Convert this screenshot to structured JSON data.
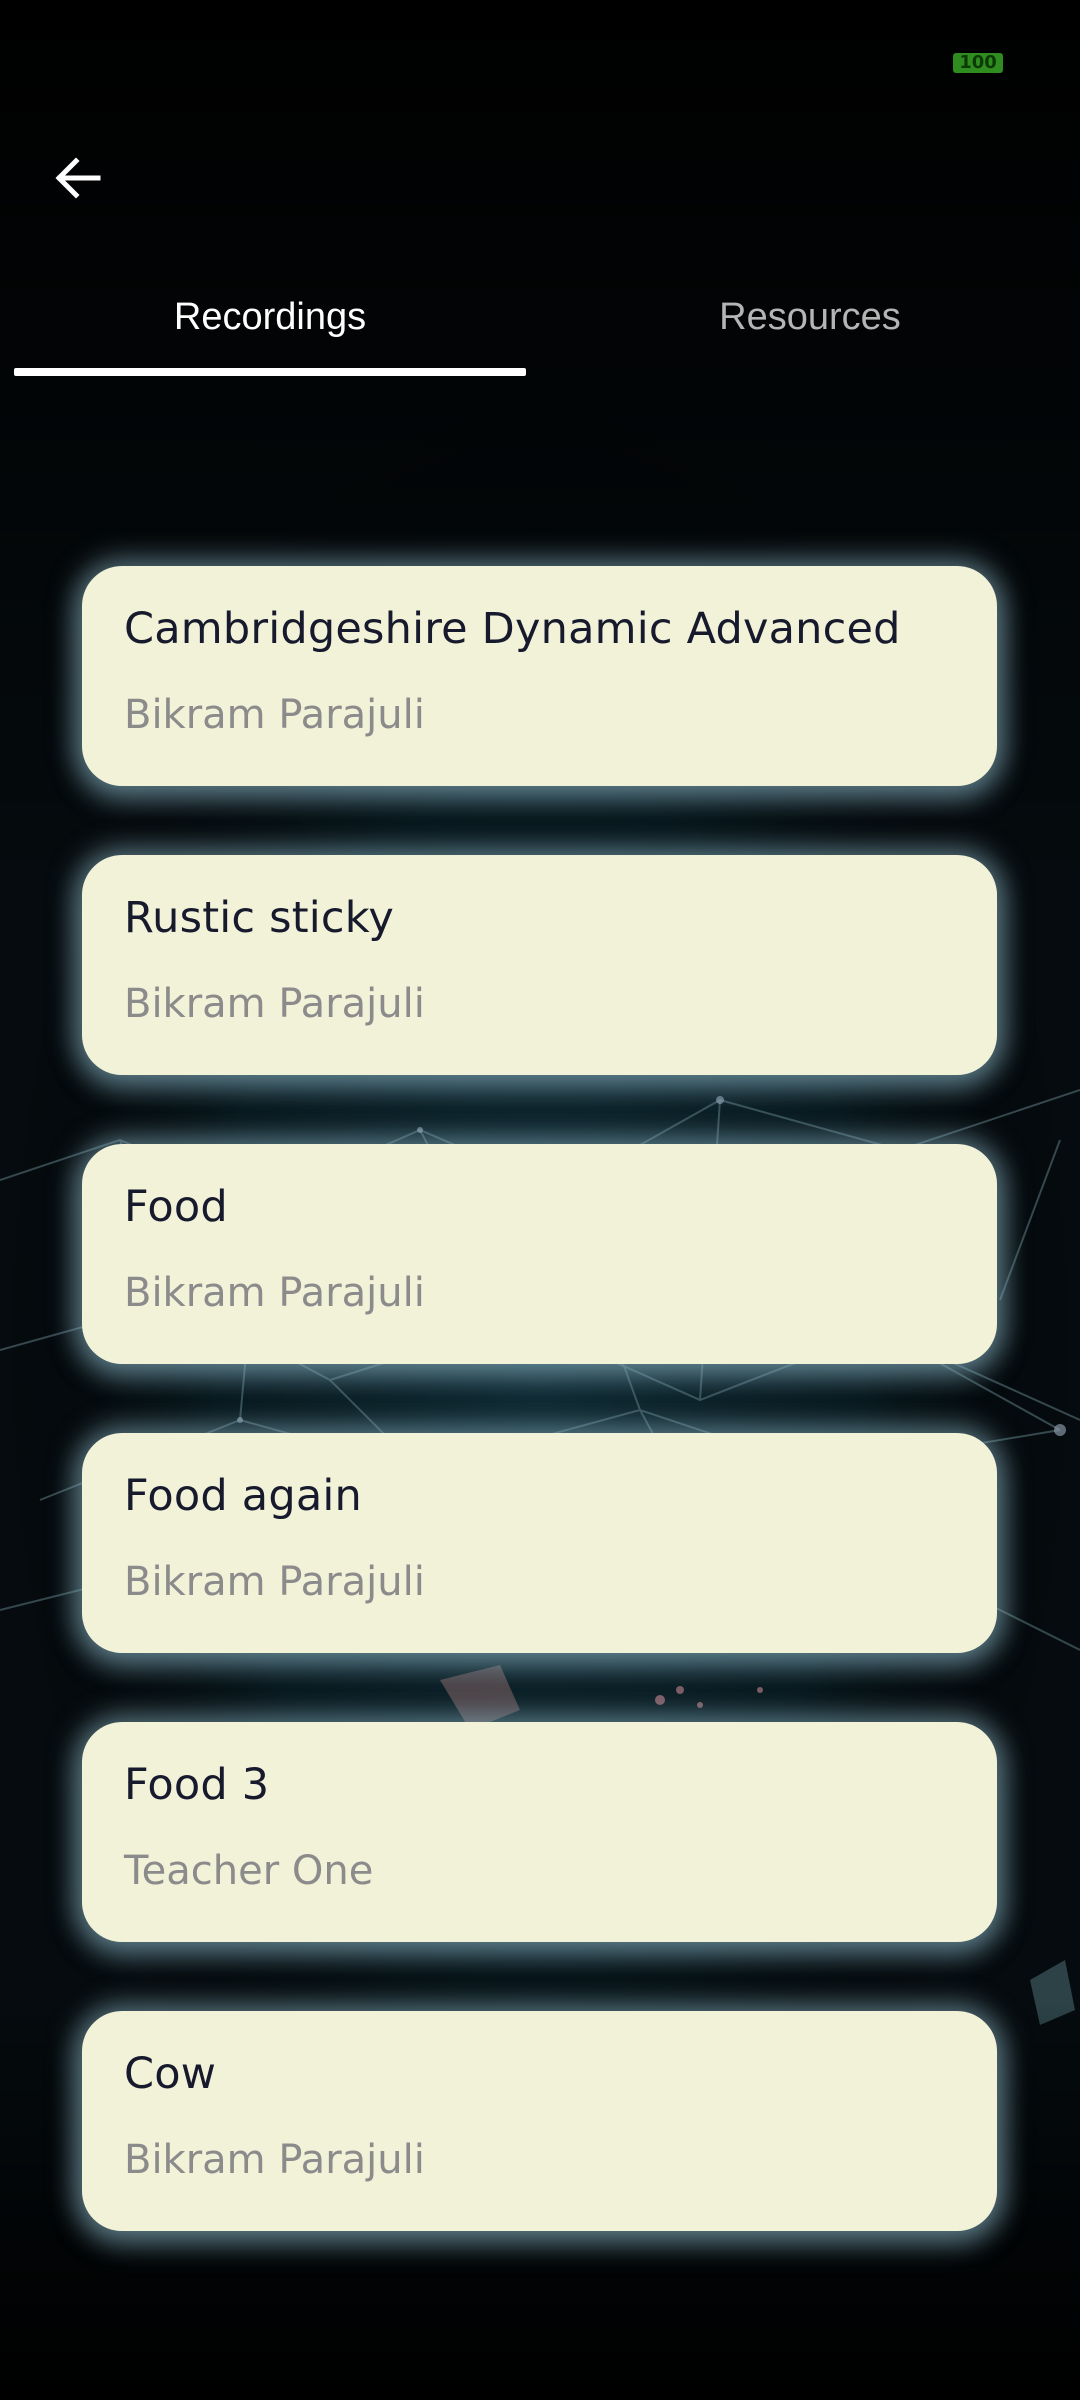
{
  "status_bar": {
    "battery_level": "100",
    "battery_color": "#2f8d1f"
  },
  "header": {
    "back_icon": "arrow-left-icon"
  },
  "tabs": [
    {
      "label": "Recordings",
      "active": true
    },
    {
      "label": "Resources",
      "active": false
    }
  ],
  "recordings": [
    {
      "title": "Cambridgeshire Dynamic Advanced",
      "author": "Bikram Parajuli"
    },
    {
      "title": "Rustic sticky",
      "author": "Bikram Parajuli"
    },
    {
      "title": "Food",
      "author": "Bikram Parajuli"
    },
    {
      "title": "Food again",
      "author": "Bikram Parajuli"
    },
    {
      "title": "Food 3",
      "author": "Teacher One"
    },
    {
      "title": "Cow",
      "author": "Bikram Parajuli"
    }
  ],
  "colors": {
    "background": "#000000",
    "card": "#f2f2d9",
    "card_title": "#171a2c",
    "card_subtitle": "#8b8b8b",
    "tab_active": "#ffffff",
    "tab_inactive": "#b5b5b5",
    "card_glow": "#8cb4c3"
  }
}
